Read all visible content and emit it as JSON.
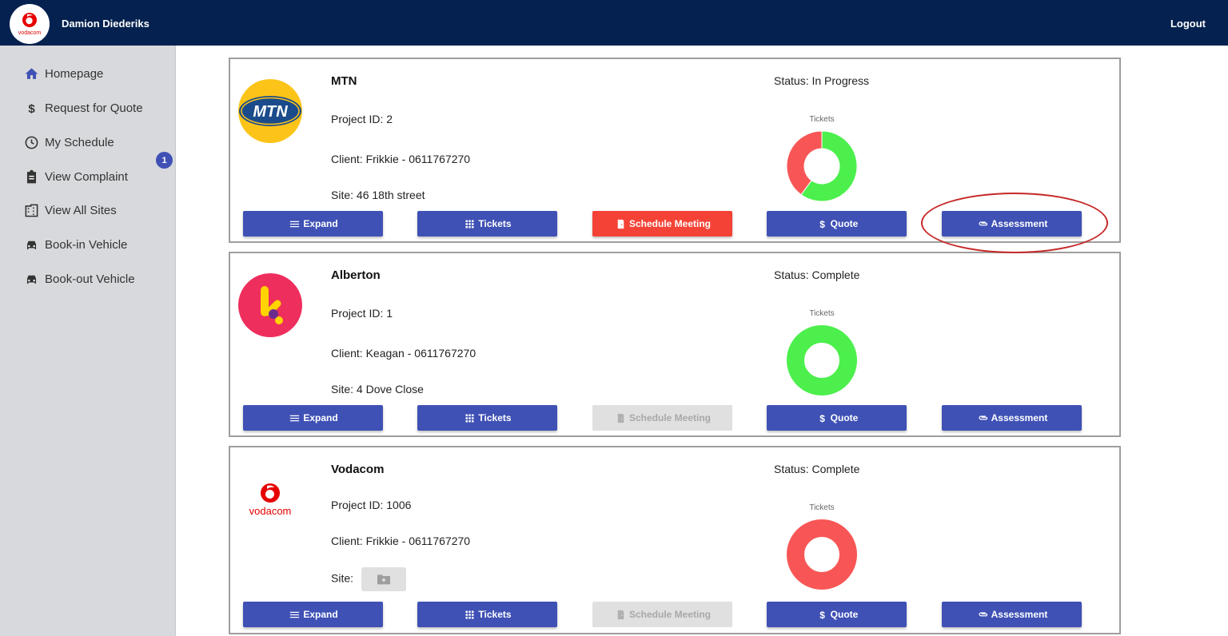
{
  "header": {
    "brand_logo_text": "vodacom",
    "user_name": "Damion Diederiks",
    "logout_label": "Logout"
  },
  "sidebar": {
    "items": [
      {
        "label": "Homepage",
        "icon": "home-icon"
      },
      {
        "label": "Request for Quote",
        "icon": "dollar-icon"
      },
      {
        "label": "My Schedule",
        "icon": "clock-icon"
      },
      {
        "label": "View Complaint",
        "icon": "clipboard-icon"
      },
      {
        "label": "View All Sites",
        "icon": "building-icon"
      },
      {
        "label": "Book-in Vehicle",
        "icon": "car-icon"
      },
      {
        "label": "Book-out Vehicle",
        "icon": "car-icon"
      }
    ],
    "badge_count": "1"
  },
  "buttons": {
    "expand": "Expand",
    "tickets": "Tickets",
    "schedule": "Schedule Meeting",
    "quote": "Quote",
    "assessment": "Assessment"
  },
  "projects": [
    {
      "name": "MTN",
      "logo_text": "MTN",
      "project_id": "Project ID: 2",
      "client": "Client: Frikkie - 0611767270",
      "site": "Site: 46 18th street",
      "status": "Status: In Progress",
      "chart_title": "Tickets",
      "schedule_enabled": true
    },
    {
      "name": "Alberton",
      "logo_text": "k",
      "project_id": "Project ID: 1",
      "client": "Client: Keagan - 0611767270",
      "site": "Site: 4 Dove Close",
      "status": "Status: Complete",
      "chart_title": "Tickets",
      "schedule_enabled": false
    },
    {
      "name": "Vodacom",
      "logo_text": "vodacom",
      "project_id": "Project ID: 1006",
      "client": "Client: Frikkie - 0611767270",
      "site": "Site:",
      "status": "Status: Complete",
      "chart_title": "Tickets",
      "schedule_enabled": false
    }
  ],
  "chart_data": [
    {
      "type": "pie",
      "title": "Tickets",
      "slices": [
        {
          "color": "#4cef4c",
          "value": 60
        },
        {
          "color": "#f85656",
          "value": 40
        }
      ]
    },
    {
      "type": "pie",
      "title": "Tickets",
      "slices": [
        {
          "color": "#4cef4c",
          "value": 100
        }
      ]
    },
    {
      "type": "pie",
      "title": "Tickets",
      "slices": [
        {
          "color": "#f85656",
          "value": 100
        }
      ]
    }
  ],
  "colors": {
    "header_bg": "#04214f",
    "primary_button": "#3f51b5",
    "danger_button": "#f44336",
    "annotation_circle": "#c62828"
  }
}
